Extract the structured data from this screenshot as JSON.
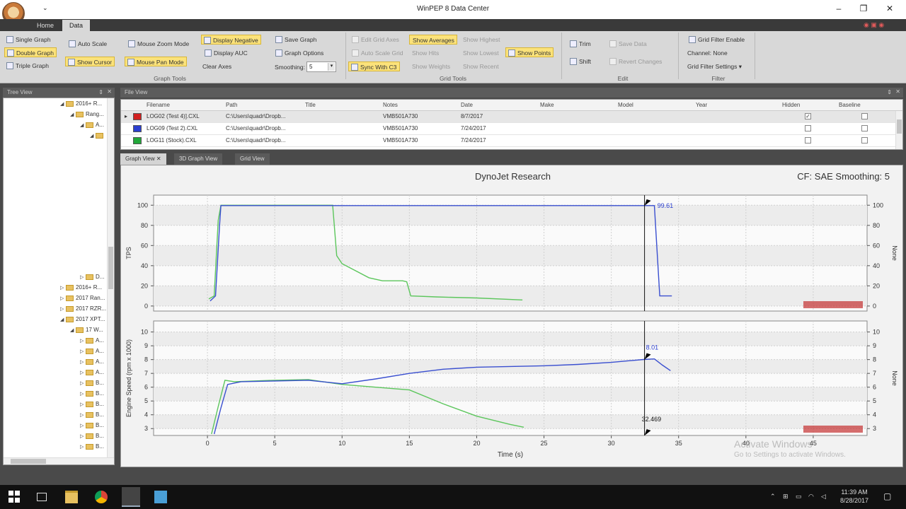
{
  "window": {
    "title": "WinPEP 8 Data Center"
  },
  "tabs": [
    {
      "label": "Home"
    },
    {
      "label": "Data"
    }
  ],
  "ribbon": {
    "graph_tools": {
      "single_graph": "Single Graph",
      "double_graph": "Double Graph",
      "triple_graph": "Triple Graph",
      "auto_scale": "Auto Scale",
      "show_cursor": "Show Cursor",
      "mouse_zoom_mode": "Mouse Zoom Mode",
      "mouse_pan_mode": "Mouse Pan Mode",
      "display_negative": "Display Negative",
      "display_auc": "Display AUC",
      "clear_axes": "Clear Axes",
      "save_graph": "Save Graph",
      "graph_options": "Graph Options",
      "smoothing_label": "Smoothing:",
      "smoothing_value": "5",
      "group_label": "Graph Tools"
    },
    "grid_tools": {
      "edit_grid_axes": "Edit Grid Axes",
      "auto_scale_grid": "Auto Scale Grid",
      "sync_with_c3": "Sync With C3",
      "show_averages": "Show Averages",
      "show_hits": "Show Hits",
      "show_weights": "Show Weights",
      "show_highest": "Show Highest",
      "show_lowest": "Show Lowest",
      "show_recent": "Show Recent",
      "show_points": "Show Points",
      "group_label": "Grid Tools"
    },
    "edit": {
      "trim": "Trim",
      "shift": "Shift",
      "save_data": "Save Data",
      "revert_changes": "Revert Changes",
      "group_label": "Edit"
    },
    "filter": {
      "grid_filter_enable": "Grid Filter Enable",
      "channel": "Channel: None",
      "grid_filter_settings": "Grid Filter Settings",
      "group_label": "Filter"
    }
  },
  "tree_view": {
    "title": "Tree View",
    "nodes": [
      {
        "label": "2016+ R...",
        "indent": 0,
        "expanded": true
      },
      {
        "label": "Rang...",
        "indent": 1,
        "expanded": true
      },
      {
        "label": "A...",
        "indent": 2,
        "expanded": true
      },
      {
        "label": "",
        "indent": 3,
        "expanded": true
      },
      {
        "label": "D...",
        "indent": 2,
        "expanded": false
      },
      {
        "label": "2016+ R...",
        "indent": 0,
        "expanded": false
      },
      {
        "label": "2017 Ran...",
        "indent": 0,
        "expanded": false
      },
      {
        "label": "2017 RZR...",
        "indent": 0,
        "expanded": false
      },
      {
        "label": "2017 XPT...",
        "indent": 0,
        "expanded": true
      },
      {
        "label": "17 W...",
        "indent": 1,
        "expanded": true
      },
      {
        "label": "A...",
        "indent": 2,
        "expanded": false
      },
      {
        "label": "A...",
        "indent": 2,
        "expanded": false
      },
      {
        "label": "A...",
        "indent": 2,
        "expanded": false
      },
      {
        "label": "A...",
        "indent": 2,
        "expanded": false
      },
      {
        "label": "B...",
        "indent": 2,
        "expanded": false
      },
      {
        "label": "B...",
        "indent": 2,
        "expanded": false
      },
      {
        "label": "B...",
        "indent": 2,
        "expanded": false
      },
      {
        "label": "B...",
        "indent": 2,
        "expanded": false
      },
      {
        "label": "B...",
        "indent": 2,
        "expanded": false
      },
      {
        "label": "B...",
        "indent": 2,
        "expanded": false
      },
      {
        "label": "B...",
        "indent": 2,
        "expanded": false
      }
    ]
  },
  "file_view": {
    "title": "File View",
    "columns": [
      "Filename",
      "Path",
      "Title",
      "Notes",
      "Date",
      "Make",
      "Model",
      "Year",
      "Hidden",
      "Baseline"
    ],
    "rows": [
      {
        "filename": "LOG02 (Test 4)].CXL",
        "path": "C:\\Users\\quadr\\Dropb...",
        "title": "",
        "notes": "VMB501A730",
        "date": "8/7/2017",
        "hidden": true,
        "baseline": false,
        "color": "#d22020"
      },
      {
        "filename": "LOG09 (Test 2).CXL",
        "path": "C:\\Users\\quadr\\Dropb...",
        "title": "",
        "notes": "VMB501A730",
        "date": "7/24/2017",
        "hidden": false,
        "baseline": false,
        "color": "#2b3fd0"
      },
      {
        "filename": "LOG11 (Stock).CXL",
        "path": "C:\\Users\\quadr\\Dropb...",
        "title": "",
        "notes": "VMB501A730",
        "date": "7/24/2017",
        "hidden": false,
        "baseline": false,
        "color": "#22a83a"
      }
    ]
  },
  "view_tabs": [
    {
      "label": "Graph View"
    },
    {
      "label": "3D Graph View"
    },
    {
      "label": "Grid View"
    }
  ],
  "graph": {
    "title": "DynoJet Research",
    "cf_label": "CF: SAE Smoothing: 5",
    "watermark_line1": "Activate Windows",
    "watermark_line2": "Go to Settings to activate Windows."
  },
  "chart_data": [
    {
      "type": "line",
      "title": "",
      "ylabel": "TPS",
      "ylabel_right": "None",
      "xlim": [
        -4,
        49
      ],
      "ylim": [
        -5,
        110
      ],
      "yticks": [
        0,
        20,
        40,
        60,
        80,
        100
      ],
      "grid": true,
      "cursor_x": 32.469,
      "cursor_label": "99.61",
      "series": [
        {
          "color": "#3a4fd0",
          "x": [
            0.2,
            0.6,
            0.9,
            1.0,
            2,
            10,
            20,
            32.4,
            33.2,
            33.6,
            34,
            34.5
          ],
          "y": [
            5,
            10,
            80,
            99.6,
            99.6,
            99.6,
            99.6,
            99.6,
            99.6,
            10,
            10,
            10
          ]
        },
        {
          "color": "#5cc65c",
          "x": [
            0.1,
            0.5,
            0.8,
            1.0,
            5,
            9.3,
            9.6,
            10,
            12,
            13,
            14.5,
            14.8,
            15.1,
            17,
            20,
            23.4
          ],
          "y": [
            7,
            10,
            85,
            100,
            100,
            100,
            50,
            42,
            28,
            25,
            25,
            24,
            10,
            9,
            8,
            6
          ]
        }
      ]
    },
    {
      "type": "line",
      "title": "",
      "ylabel": "Engine Speed (rpm x 1000)",
      "ylabel_right": "None",
      "xlabel": "Time (s)",
      "xlim": [
        -4,
        49
      ],
      "ylim": [
        2.5,
        10.8
      ],
      "xticks": [
        0,
        5,
        10,
        15,
        20,
        25,
        30,
        35,
        40,
        45
      ],
      "yticks": [
        3,
        4,
        5,
        6,
        7,
        8,
        9,
        10
      ],
      "grid": true,
      "cursor_x": 32.469,
      "cursor_label": "8.01",
      "cursor_x_label": "32.469",
      "series": [
        {
          "color": "#3a4fd0",
          "x": [
            0.5,
            1.0,
            1.5,
            2.5,
            5,
            7.5,
            10,
            12.5,
            15,
            17.5,
            20,
            22.5,
            25,
            27.5,
            30,
            32.4,
            33.2,
            33.8,
            34.4
          ],
          "y": [
            2.6,
            4.5,
            6.2,
            6.4,
            6.45,
            6.5,
            6.25,
            6.6,
            7.0,
            7.3,
            7.45,
            7.5,
            7.55,
            7.65,
            7.8,
            8.01,
            8.05,
            7.6,
            7.2
          ]
        },
        {
          "color": "#5cc65c",
          "x": [
            0.3,
            0.8,
            1.3,
            2,
            5,
            7.5,
            10,
            12.5,
            15,
            17.5,
            20,
            22.5,
            23.5
          ],
          "y": [
            2.6,
            4.6,
            6.5,
            6.4,
            6.5,
            6.55,
            6.2,
            6.0,
            5.8,
            4.8,
            3.9,
            3.3,
            3.1
          ]
        }
      ]
    }
  ],
  "taskbar": {
    "time": "11:39 AM",
    "date": "8/28/2017"
  }
}
